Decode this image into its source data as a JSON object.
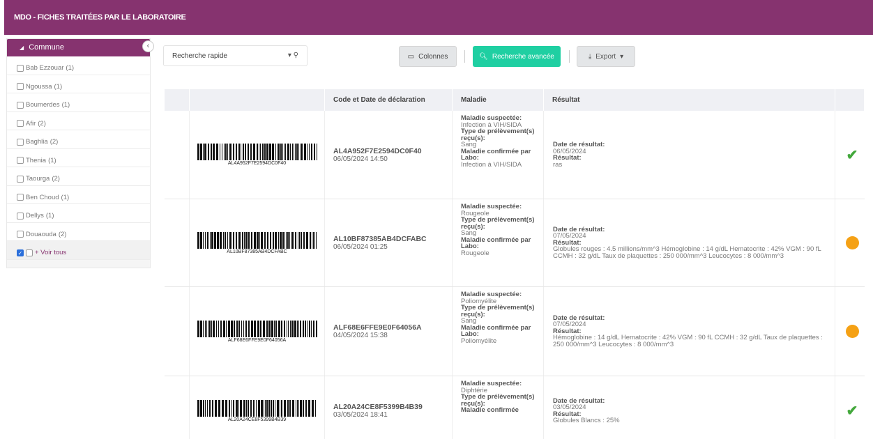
{
  "header": {
    "title": "MDO - FICHES TRAITÉES PAR LE LABORATOIRE"
  },
  "sidebar": {
    "heading": "Commune",
    "collapse_glyph": "‹",
    "items": [
      {
        "label": "Bab Ezzouar",
        "count": "(1)"
      },
      {
        "label": "Ngoussa",
        "count": "(1)"
      },
      {
        "label": "Boumerdes",
        "count": "(1)"
      },
      {
        "label": "Afir",
        "count": "(2)"
      },
      {
        "label": "Baghlia",
        "count": "(2)"
      },
      {
        "label": "Thenia",
        "count": "(1)"
      },
      {
        "label": "Taourga",
        "count": "(2)"
      },
      {
        "label": "Ben Choud",
        "count": "(1)"
      },
      {
        "label": "Dellys",
        "count": "(1)"
      },
      {
        "label": "Douaouda",
        "count": "(2)"
      }
    ],
    "voir_tous": "+ Voir tous"
  },
  "toolbar": {
    "search_placeholder": "Recherche rapide",
    "colonnes": "Colonnes",
    "recherche_avancee": "Recherche avancée",
    "export": "Export",
    "accent_color": "#1fcfa2"
  },
  "table": {
    "headers": [
      "",
      "",
      "Code et Date de déclaration",
      "Maladie",
      "Résultat",
      ""
    ],
    "rows": [
      {
        "barcode": "AL4A952F7E2594DC0F40",
        "code": "AL4A952F7E2594DC0F40",
        "date": "06/05/2024 14:50",
        "maladie_suspectee_label": "Maladie suspectée:",
        "maladie_suspectee": "Infection à VIH/SIDA",
        "type_label": "Type de prélèvement(s) reçu(s):",
        "type": "Sang",
        "confirmee_label": "Maladie confirmée par Labo:",
        "confirmee": "Infection à VIH/SIDA",
        "date_resultat_label": "Date de résultat:",
        "date_resultat": "06/05/2024",
        "resultat_label": "Résultat:",
        "resultat": "ras",
        "status": "check"
      },
      {
        "barcode": "AL10BF87385AB4DCFABC",
        "code": "AL10BF87385AB4DCFABC",
        "date": "06/05/2024 01:25",
        "maladie_suspectee_label": "Maladie suspectée:",
        "maladie_suspectee": "Rougeole",
        "type_label": "Type de prélèvement(s) reçu(s):",
        "type": "Sang",
        "confirmee_label": "Maladie confirmée par Labo:",
        "confirmee": "Rougeole",
        "date_resultat_label": "Date de résultat:",
        "date_resultat": "07/05/2024",
        "resultat_label": "Résultat:",
        "resultat": "Globules rouges : 4.5 millions/mm^3 Hémoglobine : 14 g/dL Hematocrite : 42% VGM : 90 fL CCMH : 32 g/dL Taux de plaquettes : 250 000/mm^3 Leucocytes : 8 000/mm^3",
        "status": "pending"
      },
      {
        "barcode": "ALF68E6FFE9E0F64056A",
        "code": "ALF68E6FFE9E0F64056A",
        "date": "04/05/2024 15:38",
        "maladie_suspectee_label": "Maladie suspectée:",
        "maladie_suspectee": "Poliomyélite",
        "type_label": "Type de prélèvement(s) reçu(s):",
        "type": "Sang",
        "confirmee_label": "Maladie confirmée par Labo:",
        "confirmee": "Poliomyélite",
        "date_resultat_label": "Date de résultat:",
        "date_resultat": "07/05/2024",
        "resultat_label": "Résultat:",
        "resultat": "Hémoglobine : 14 g/dL Hematocrite : 42% VGM : 90 fL CCMH : 32 g/dL Taux de plaquettes : 250 000/mm^3 Leucocytes : 8 000/mm^3",
        "status": "pending"
      },
      {
        "barcode": "AL20A24CE8F5399B4B39",
        "code": "AL20A24CE8F5399B4B39",
        "date": "03/05/2024 18:41",
        "maladie_suspectee_label": "Maladie suspectée:",
        "maladie_suspectee": "Diphtérie",
        "type_label": "Type de prélèvement(s) reçu(s):",
        "type": "",
        "confirmee_label": "Maladie confirmée",
        "confirmee": "",
        "date_resultat_label": "Date de résultat:",
        "date_resultat": "03/05/2024",
        "resultat_label": "Résultat:",
        "resultat": "Globules Blancs : 25%",
        "status": "check"
      }
    ]
  },
  "colors": {
    "brand": "#86336f",
    "check": "#43a83c",
    "pending": "#f5a115"
  }
}
